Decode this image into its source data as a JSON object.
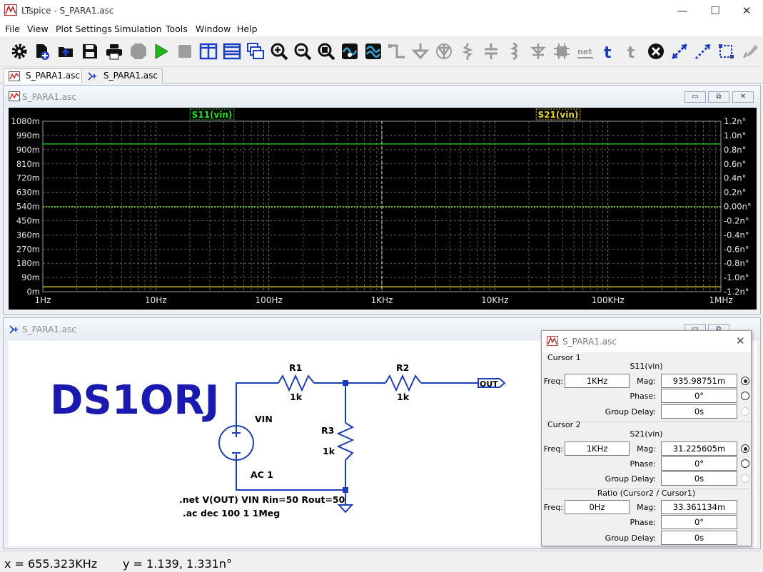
{
  "app": {
    "title": "LTspice - S_PARA1.asc",
    "minimize": "—",
    "maximize": "☐",
    "close": "✕"
  },
  "menu": [
    "File",
    "View",
    "Plot Settings",
    "Simulation",
    "Tools",
    "Window",
    "Help"
  ],
  "toolbar": [
    "settings-icon",
    "new-schematic-icon",
    "open-icon",
    "save-icon",
    "print-icon",
    "halt-icon",
    "run-icon",
    "stop-icon",
    "tile-vertical-icon",
    "tile-horizontal-icon",
    "cascade-icon",
    "zoom-in-icon",
    "zoom-out-icon",
    "zoom-fit-icon",
    "autorange-icon",
    "waveform-icon",
    "wire-icon",
    "ground-icon",
    "diode-icon",
    "resistor-icon",
    "capacitor-icon",
    "inductor-icon",
    "diode2-icon",
    "component-icon",
    "net-label-icon",
    "text-icon",
    "spice-directive-icon",
    "delete-icon",
    "move-icon",
    "drag-icon",
    "mirror-icon",
    "rotate-icon"
  ],
  "tabs": [
    {
      "label": "S_PARA1.asc",
      "active": true
    },
    {
      "label": "S_PARA1.asc",
      "active": false
    }
  ],
  "waveform_window": {
    "title": "S_PARA1.asc",
    "min": "▭",
    "restore": "⧉",
    "close": "✕"
  },
  "chart_data": {
    "type": "line",
    "x_scale": "log",
    "x_ticks": [
      "1Hz",
      "10Hz",
      "100Hz",
      "1KHz",
      "10KHz",
      "100KHz",
      "1MHz"
    ],
    "y_left_ticks": [
      "1080m",
      "990m",
      "900m",
      "810m",
      "720m",
      "630m",
      "540m",
      "450m",
      "360m",
      "270m",
      "180m",
      "90m",
      "0m"
    ],
    "y_right_ticks": [
      "1.2n°",
      "1.0n°",
      "0.8n°",
      "0.6n°",
      "0.4n°",
      "0.2n°",
      "0.00n°",
      "-0.2n°",
      "-0.4n°",
      "-0.6n°",
      "-0.8n°",
      "-1.0n°",
      "-1.2n°"
    ],
    "series": [
      {
        "name": "S11(vin)",
        "color": "#22dd22",
        "mag": 0.93598751
      },
      {
        "name": "S21(vin)",
        "color": "#e6d422",
        "mag": 0.031225605
      }
    ],
    "ylim_left": [
      0,
      1.08
    ],
    "cursor_x": "1KHz",
    "grid": true
  },
  "schematic_window": {
    "title": "S_PARA1.asc"
  },
  "schematic": {
    "callsign": "DS1ORJ",
    "components": [
      {
        "ref": "R1",
        "value": "1k"
      },
      {
        "ref": "R2",
        "value": "1k"
      },
      {
        "ref": "R3",
        "value": "1k"
      },
      {
        "ref": "VIN",
        "value": "AC 1"
      }
    ],
    "out_label": "OUT",
    "directives": [
      ".net V(OUT) VIN Rin=50 Rout=50",
      ".ac dec 100 1 1Meg"
    ]
  },
  "cursor_panel": {
    "title": "S_PARA1.asc",
    "cursor1": {
      "title": "Cursor 1",
      "trace": "S11(vin)",
      "freq": "1KHz",
      "mag": "935.98751m",
      "phase": "0°",
      "group_delay": "0s"
    },
    "cursor2": {
      "title": "Cursor 2",
      "trace": "S21(vin)",
      "freq": "1KHz",
      "mag": "31.225605m",
      "phase": "0°",
      "group_delay": "0s"
    },
    "ratio": {
      "title": "Ratio (Cursor2 / Cursor1)",
      "freq": "0Hz",
      "mag": "33.361134m",
      "phase": "0°",
      "group_delay": "0s"
    },
    "labels": {
      "freq": "Freq:",
      "mag": "Mag:",
      "phase": "Phase:",
      "group_delay": "Group Delay:"
    }
  },
  "status": {
    "x": "x = 655.323KHz",
    "y": "y = 1.139, 1.331n°"
  }
}
